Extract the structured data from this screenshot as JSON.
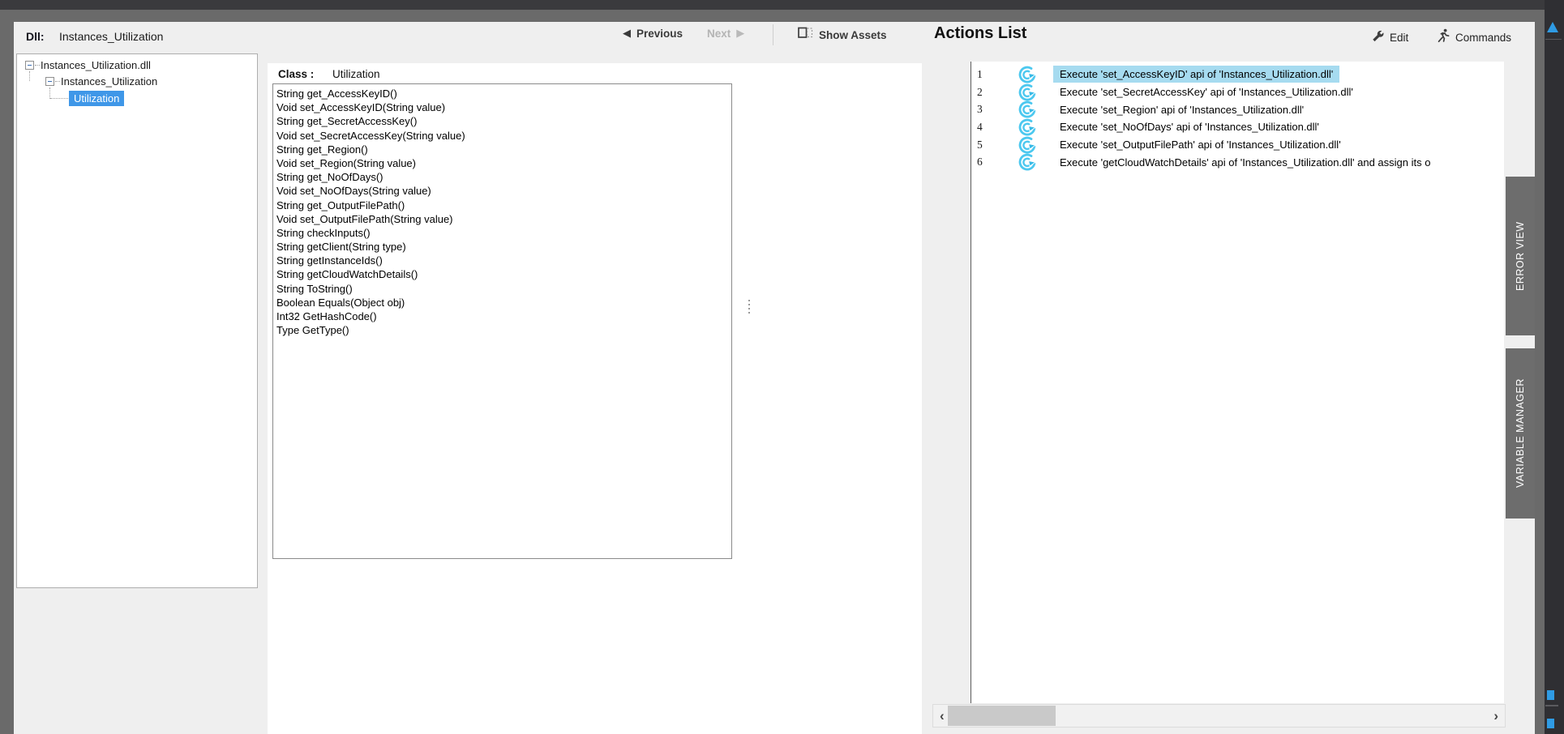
{
  "colors": {
    "tree_selection": "#3f97e8",
    "action_row_selection": "#a6dbf0",
    "action_icon_cyan": "#4cc8ef",
    "side_tab_bg": "#6d6d6d",
    "frame_gray": "#6a6a6a"
  },
  "header": {
    "dll_label": "Dll:",
    "dll_value": "Instances_Utilization",
    "previous_label": "Previous",
    "next_label": "Next",
    "show_assets_label": "Show Assets",
    "prev_arrow_glyph": "◀",
    "next_arrow_glyph": "▶"
  },
  "tree": {
    "root": "Instances_Utilization.dll",
    "child": "Instances_Utilization",
    "selected": "Utilization"
  },
  "class_panel": {
    "label": "Class :",
    "name": "Utilization",
    "methods": [
      "String get_AccessKeyID()",
      "Void set_AccessKeyID(String value)",
      "String get_SecretAccessKey()",
      "Void set_SecretAccessKey(String value)",
      "String get_Region()",
      "Void set_Region(String value)",
      "String get_NoOfDays()",
      "Void set_NoOfDays(String value)",
      "String get_OutputFilePath()",
      "Void set_OutputFilePath(String value)",
      "String checkInputs()",
      "String getClient(String type)",
      "String getInstanceIds()",
      "String getCloudWatchDetails()",
      "String ToString()",
      "Boolean Equals(Object obj)",
      "Int32 GetHashCode()",
      "Type GetType()"
    ]
  },
  "actions": {
    "title": "Actions List",
    "edit_label": "Edit",
    "commands_label": "Commands",
    "rows": [
      {
        "num": "1",
        "text": "Execute 'set_AccessKeyID' api of 'Instances_Utilization.dll'",
        "selected": true
      },
      {
        "num": "2",
        "text": "Execute 'set_SecretAccessKey' api of 'Instances_Utilization.dll'",
        "selected": false
      },
      {
        "num": "3",
        "text": "Execute 'set_Region' api of 'Instances_Utilization.dll'",
        "selected": false
      },
      {
        "num": "4",
        "text": "Execute 'set_NoOfDays' api of 'Instances_Utilization.dll'",
        "selected": false
      },
      {
        "num": "5",
        "text": "Execute 'set_OutputFilePath' api of 'Instances_Utilization.dll'",
        "selected": false
      },
      {
        "num": "6",
        "text": "Execute 'getCloudWatchDetails' api of 'Instances_Utilization.dll' and assign its o",
        "selected": false
      }
    ]
  },
  "side_tabs": {
    "error_view": "ERROR VIEW",
    "variable_manager": "VARIABLE MANAGER"
  },
  "scrollbar": {
    "left_arrow": "‹",
    "right_arrow": "›"
  }
}
